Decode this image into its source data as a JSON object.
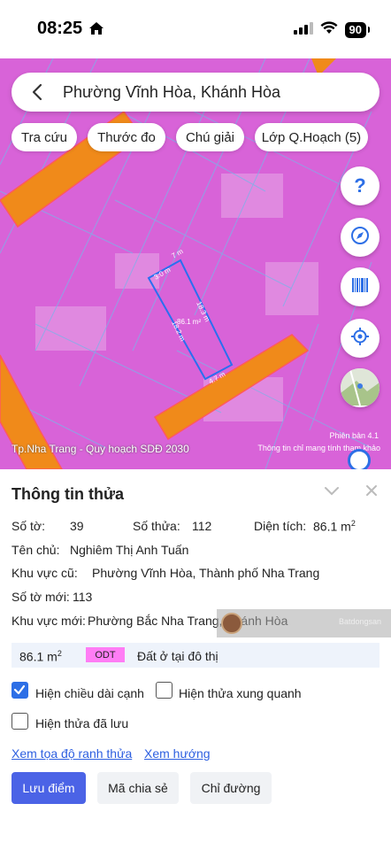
{
  "status": {
    "time": "08:25",
    "battery": "90"
  },
  "search": {
    "text": "Phường Vĩnh Hòa, Khánh Hòa"
  },
  "chips": [
    {
      "label": "Tra cứu"
    },
    {
      "label": "Thước đo"
    },
    {
      "label": "Chú giải"
    },
    {
      "label": "Lớp Q.Hoạch (5)"
    }
  ],
  "map": {
    "help": "?",
    "measure_top": "3.0 m",
    "measure_top_b": "7 m",
    "measure_right": "18.3 m",
    "measure_left": "18.2 m",
    "measure_area": "86.1 m²",
    "measure_bottom": "4.7 m",
    "label_left": "Tp.Nha Trang - Quy hoạch SDĐ 2030",
    "label_right_1": "Phiên bản 4.1",
    "label_right_2": "Thông tin chỉ mang tính tham khảo"
  },
  "panel": {
    "title": "Thông tin thửa",
    "so_to_label": "Số tờ:",
    "so_to_value": "39",
    "so_thua_label": "Số thửa:",
    "so_thua_value": "112",
    "dien_tich_label": "Diện tích:",
    "dien_tich_value": "86.1 m",
    "dien_tich_unit": "2",
    "ten_chu_label": "Tên chủ:",
    "ten_chu_value": "Nghiêm Thị Anh Tuấn",
    "kv_cu_label": "Khu vực cũ:",
    "kv_cu_value": "Phường Vĩnh Hòa, Thành phố Nha Trang",
    "so_to_moi_label": "Số tờ mới:",
    "so_to_moi_value": "113",
    "kv_moi_label": "Khu vực mới:",
    "kv_moi_value": "Phường Bắc Nha Trang, Khánh Hòa",
    "watermark": "Batdongsan",
    "area_value": "86.1 m",
    "area_unit": "2",
    "odt": "ODT",
    "land_type": "Đất ở tại đô thị"
  },
  "options": {
    "show_edge_length": {
      "label": "Hiện chiều dài cạnh",
      "checked": true
    },
    "show_nearby": {
      "label": "Hiện thửa xung quanh",
      "checked": false
    },
    "show_saved": {
      "label": "Hiện thửa đã lưu",
      "checked": false
    }
  },
  "links": {
    "coords": "Xem tọa độ ranh thửa",
    "direction": "Xem hướng"
  },
  "buttons": {
    "save": "Lưu điểm",
    "share": "Mã chia sẻ",
    "directions": "Chỉ đường"
  },
  "colors": {
    "accent": "#4b63e6",
    "link": "#2d5fe0",
    "zone_pink": "#d863d8",
    "road_orange": "#f08a1a",
    "odt_badge": "#ff7df5"
  }
}
